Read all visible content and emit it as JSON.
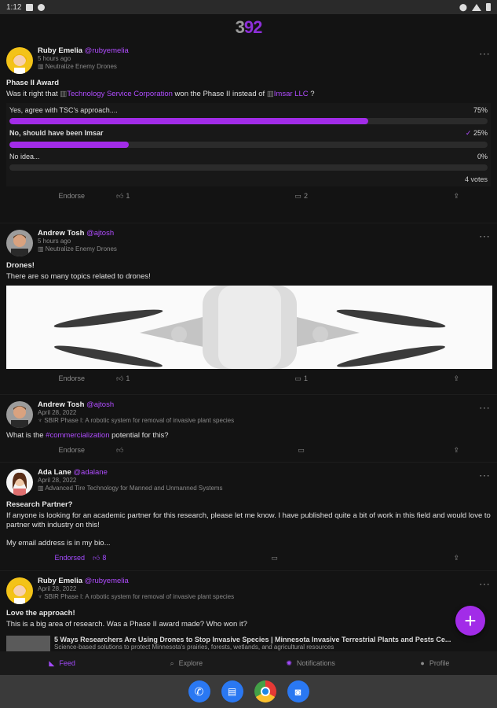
{
  "status": {
    "time": "1:12"
  },
  "logo": {
    "part1": "3",
    "part2": "92"
  },
  "posts": [
    {
      "author": "Ruby Emelia",
      "handle": "@rubyemelia",
      "time": "5 hours ago",
      "topic": "Neutralize Enemy Drones",
      "title": "Phase II Award",
      "text_pre": "Was it right that ",
      "link1": "Technology Service Corporation",
      "text_mid": " won the Phase II instead of ",
      "link2": "Imsar LLC",
      "text_post": " ?",
      "poll": [
        {
          "label": "Yes, agree with TSC's approach....",
          "pct_label": "75%",
          "pct": 75
        },
        {
          "label": "No, should have been Imsar",
          "pct_label": "25%",
          "pct": 25,
          "checked": "✓"
        },
        {
          "label": "No idea...",
          "pct_label": "0%",
          "pct": 0
        }
      ],
      "votes": "4 votes",
      "endorse": "Endorse",
      "thumbs": "1",
      "comments": "2"
    },
    {
      "author": "Andrew Tosh",
      "handle": "@ajtosh",
      "time": "5 hours ago",
      "topic": "Neutralize Enemy Drones",
      "title": "Drones!",
      "text": "There are so many topics related to drones!",
      "endorse": "Endorse",
      "thumbs": "1",
      "comments": "1"
    },
    {
      "author": "Andrew Tosh",
      "handle": "@ajtosh",
      "time": "April 28, 2022",
      "topic": "SBIR Phase I: A robotic system for removal of invasive plant species",
      "text_pre": "What is the ",
      "hashtag": "#commercialization",
      "text_post": " potential for this?",
      "endorse": "Endorse"
    },
    {
      "author": "Ada Lane",
      "handle": "@adalane",
      "time": "April 28, 2022",
      "topic": "Advanced Tire Technology for Manned and Unmanned Systems",
      "title": "Research Partner?",
      "text": "If anyone is looking for an academic partner for this research, please let me know. I have published quite a bit of work in this field and would love to partner with industry on this!",
      "text2": "My email address is in my bio...",
      "endorse": "Endorsed",
      "thumbs": "8"
    },
    {
      "author": "Ruby Emelia",
      "handle": "@rubyemelia",
      "time": "April 28, 2022",
      "topic": "SBIR Phase I: A robotic system for removal of invasive plant species",
      "title": "Love the approach!",
      "text": "This is a big area of research. Was a Phase II award made? Who won it?",
      "preview_title": "5 Ways Researchers Are Using Drones to Stop Invasive Species | Minnesota Invasive Terrestrial Plants and Pests Ce...",
      "preview_desc": "Science-based solutions to protect Minnesota's prairies, forests, wetlands, and agricultural resources"
    }
  ],
  "nav": {
    "feed": "Feed",
    "explore": "Explore",
    "notifications": "Notifications",
    "profile": "Profile"
  },
  "colors": {
    "accent": "#a22ce8",
    "bg": "#131313"
  }
}
